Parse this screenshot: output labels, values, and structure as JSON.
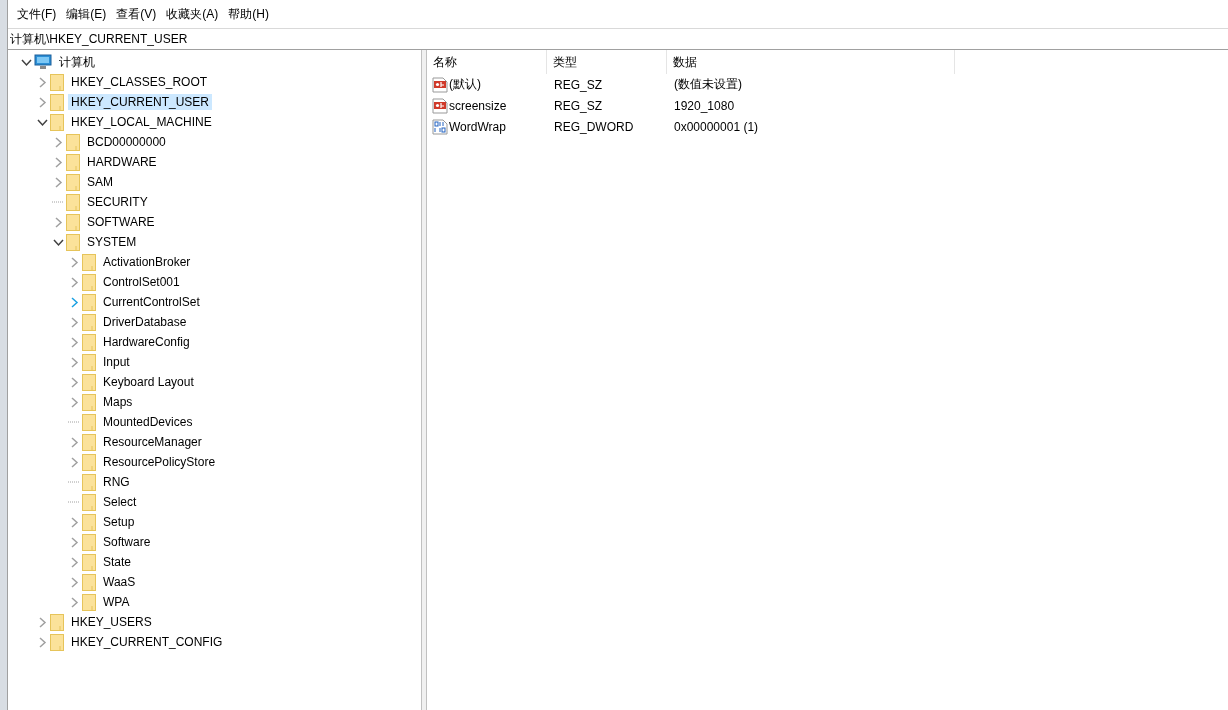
{
  "menu": [
    "文件(F)",
    "编辑(E)",
    "查看(V)",
    "收藏夹(A)",
    "帮助(H)"
  ],
  "address": "计算机\\HKEY_CURRENT_USER",
  "tree": {
    "label": "计算机",
    "expandable": true,
    "expanded": true,
    "selected": false,
    "hovered": false,
    "children": [
      {
        "label": "HKEY_CLASSES_ROOT",
        "expandable": true,
        "expanded": false,
        "selected": false,
        "hovered": false
      },
      {
        "label": "HKEY_CURRENT_USER",
        "expandable": true,
        "expanded": false,
        "selected": true,
        "hovered": false
      },
      {
        "label": "HKEY_LOCAL_MACHINE",
        "expandable": true,
        "expanded": true,
        "selected": false,
        "hovered": false,
        "children": [
          {
            "label": "BCD00000000",
            "expandable": true,
            "expanded": false,
            "selected": false,
            "hovered": false
          },
          {
            "label": "HARDWARE",
            "expandable": true,
            "expanded": false,
            "selected": false,
            "hovered": false
          },
          {
            "label": "SAM",
            "expandable": true,
            "expanded": false,
            "selected": false,
            "hovered": false
          },
          {
            "label": "SECURITY",
            "expandable": false,
            "selected": false
          },
          {
            "label": "SOFTWARE",
            "expandable": true,
            "expanded": false,
            "selected": false,
            "hovered": false
          },
          {
            "label": "SYSTEM",
            "expandable": true,
            "expanded": true,
            "selected": false,
            "hovered": false,
            "children": [
              {
                "label": "ActivationBroker",
                "expandable": true,
                "expanded": false,
                "selected": false,
                "hovered": false
              },
              {
                "label": "ControlSet001",
                "expandable": true,
                "expanded": false,
                "selected": false,
                "hovered": false
              },
              {
                "label": "CurrentControlSet",
                "expandable": true,
                "expanded": false,
                "selected": false,
                "hovered": true
              },
              {
                "label": "DriverDatabase",
                "expandable": true,
                "expanded": false,
                "selected": false,
                "hovered": false
              },
              {
                "label": "HardwareConfig",
                "expandable": true,
                "expanded": false,
                "selected": false,
                "hovered": false
              },
              {
                "label": "Input",
                "expandable": true,
                "expanded": false,
                "selected": false,
                "hovered": false
              },
              {
                "label": "Keyboard Layout",
                "expandable": true,
                "expanded": false,
                "selected": false,
                "hovered": false
              },
              {
                "label": "Maps",
                "expandable": true,
                "expanded": false,
                "selected": false,
                "hovered": false
              },
              {
                "label": "MountedDevices",
                "expandable": false,
                "selected": false
              },
              {
                "label": "ResourceManager",
                "expandable": true,
                "expanded": false,
                "selected": false,
                "hovered": false
              },
              {
                "label": "ResourcePolicyStore",
                "expandable": true,
                "expanded": false,
                "selected": false,
                "hovered": false
              },
              {
                "label": "RNG",
                "expandable": false,
                "selected": false
              },
              {
                "label": "Select",
                "expandable": false,
                "selected": false
              },
              {
                "label": "Setup",
                "expandable": true,
                "expanded": false,
                "selected": false,
                "hovered": false
              },
              {
                "label": "Software",
                "expandable": true,
                "expanded": false,
                "selected": false,
                "hovered": false
              },
              {
                "label": "State",
                "expandable": true,
                "expanded": false,
                "selected": false,
                "hovered": false
              },
              {
                "label": "WaaS",
                "expandable": true,
                "expanded": false,
                "selected": false,
                "hovered": false
              },
              {
                "label": "WPA",
                "expandable": true,
                "expanded": false,
                "selected": false,
                "hovered": false
              }
            ]
          }
        ]
      },
      {
        "label": "HKEY_USERS",
        "expandable": true,
        "expanded": false,
        "selected": false,
        "hovered": false
      },
      {
        "label": "HKEY_CURRENT_CONFIG",
        "expandable": true,
        "expanded": false,
        "selected": false,
        "hovered": false
      }
    ]
  },
  "list": {
    "columns": [
      "名称",
      "类型",
      "数据"
    ],
    "rows": [
      {
        "kind": "string",
        "name": "(默认)",
        "type": "REG_SZ",
        "data": "(数值未设置)"
      },
      {
        "kind": "string",
        "name": "screensize",
        "type": "REG_SZ",
        "data": "1920_1080"
      },
      {
        "kind": "binary",
        "name": "WordWrap",
        "type": "REG_DWORD",
        "data": "0x00000001 (1)"
      }
    ]
  }
}
